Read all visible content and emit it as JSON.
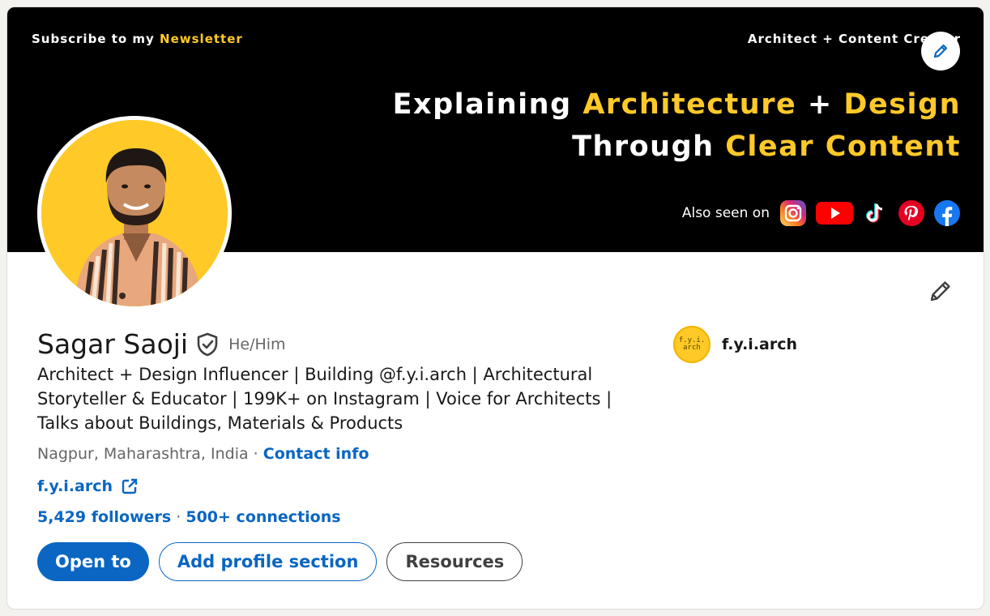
{
  "banner": {
    "subscribe_prefix": "Subscribe to my ",
    "subscribe_highlight": "Newsletter",
    "tagline": "Architect + Content Creator",
    "headline_line1_white": "Explaining ",
    "headline_line1_yellow_a": "Architecture",
    "headline_line1_plus": " + ",
    "headline_line1_yellow_b": "Design",
    "headline_line2_white": "Through ",
    "headline_line2_yellow": "Clear Content",
    "also_seen_on": "Also seen on",
    "social_icons": [
      "instagram-icon",
      "youtube-icon",
      "tiktok-icon",
      "pinterest-icon",
      "facebook-icon"
    ]
  },
  "profile": {
    "name": "Sagar Saoji",
    "pronouns": "He/Him",
    "headline": "Architect + Design Influencer | Building @f.y.i.arch | Architectural Storyteller & Educator | 199K+ on Instagram | Voice for Architects | Talks about Buildings, Materials & Products",
    "location": "Nagpur, Maharashtra, India",
    "separator": " · ",
    "contact_info": "Contact info",
    "website": "f.y.i.arch",
    "followers": "5,429 followers",
    "stats_separator": " · ",
    "connections": "500+ connections"
  },
  "company": {
    "logo_text": "f.y.i.\narch",
    "name": "f.y.i.arch"
  },
  "actions": {
    "open_to": "Open to",
    "add_section": "Add profile section",
    "resources": "Resources"
  },
  "colors": {
    "accent": "#0a66c2",
    "banner_yellow": "#ffc928",
    "banner_bg": "#000000"
  }
}
